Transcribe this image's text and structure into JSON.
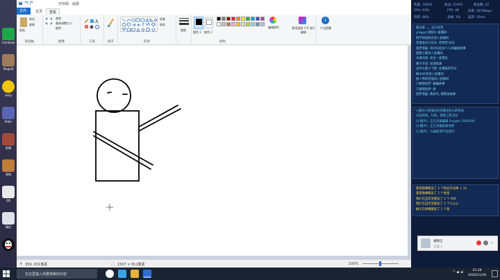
{
  "window": {
    "title": "无标题 - 画图",
    "tabs": {
      "file": "文件",
      "home": "主页",
      "view": "查看"
    }
  },
  "ribbon": {
    "clipboard": {
      "paste": "粘贴",
      "cut": "剪切",
      "copy": "复制",
      "label": "剪贴板"
    },
    "image": {
      "crop": "裁剪",
      "resize": "重新调整大小",
      "rotate": "旋转",
      "label": "图像"
    },
    "tools": {
      "label": "工具"
    },
    "brushes": {
      "label": "刷子"
    },
    "shapes": {
      "outline": "轮廓",
      "fill": "填充",
      "label": "形状"
    },
    "size": {
      "label": "粗细"
    },
    "color1": {
      "label": "颜色 1"
    },
    "color2": {
      "label": "颜色 2"
    },
    "colors_label": "颜色",
    "edit_colors": "编辑颜色",
    "paint3d": "使用画图 3 D 进行编辑",
    "product_alert": "产品提醒",
    "palette": [
      "#000000",
      "#7f7f7f",
      "#880015",
      "#ed1c24",
      "#ff7f27",
      "#fff200",
      "#22b14c",
      "#00a2e8",
      "#3f48cc",
      "#a349a4",
      "#ffffff",
      "#c3c3c3",
      "#b97a57",
      "#ffaec9",
      "#ffc90e",
      "#efe4b0",
      "#b5e61d",
      "#99d9ea",
      "#7092be",
      "#c8bfe7"
    ]
  },
  "status": {
    "cursor_pos": "359, 631像素",
    "canvas_size": "1507 × 811像素",
    "zoom": "100%"
  },
  "stream_stats": {
    "r1": [
      "热度: 35816",
      "关注: 21945",
      "粉丝数: 12"
    ],
    "r2": [
      "CPU: 93%",
      "FPS: 48",
      "码率: 3679kbps"
    ],
    "r3": [
      "内存: 66%",
      "丢帧: 1%",
      "延迟: 35ms"
    ]
  },
  "chat_messages": [
    "路过客: 。。这么优秀",
    "yingyy小鹏进入直播间",
    "我不知道依云进入直播间",
    "普通会员小乐乐: 哈哈哈 好玩",
    "旅梦清晨: 有好玩是多少人的编程故事",
    "楚楚小夏进入直播间",
    "沐香托窗: 关注一波博主",
    "橘子才说: 加油加油",
    "这木头菌小飞侠: 主播画的可以",
    "枫de声音进入直播间",
    "搞人熊的老骚进入直播间",
    "只要嗯哒梦: 编编故事",
    "只要嗯哒梦: 嗯",
    "旅梦清晨: 教多吗, 嗯嗯说故事"
  ],
  "gift_messages": [
    "小鹏声小新播出的常量发射火箭资助",
    "点击新闻，礼物，需要上新活动",
    "[小鹏声]：正在连接编辑 Oxygen 3546294",
    "[小鹏声]：正在为编程课进修",
    "[小鹏声]：与编程课学会提问"
  ],
  "reward_messages": [
    "夏夜微嘲赠送了 1 个粉丝荧光棒 × 10",
    "夏夜微嘲赠送了 1 个星星",
    "我们在囚牢里赠送了 1 个 666",
    "我们在囚牢里赠送了 1 个小心心",
    "橘子在呼嘲赠送了 1 个星"
  ],
  "notification": {
    "name": "婚圈全",
    "status": "已是少"
  },
  "taskbar": {
    "search_placeholder": "在这里输入你要搜索的内容",
    "time": "21:28",
    "date": "2020/11/29"
  },
  "desktop_icons": [
    "Camtasia",
    "MagicB",
    "Unity",
    "Rider",
    "剪辑",
    "游戏",
    "QQ",
    "微信"
  ],
  "drawing": {
    "tool": "pencil",
    "stroke_color": "#000000"
  }
}
